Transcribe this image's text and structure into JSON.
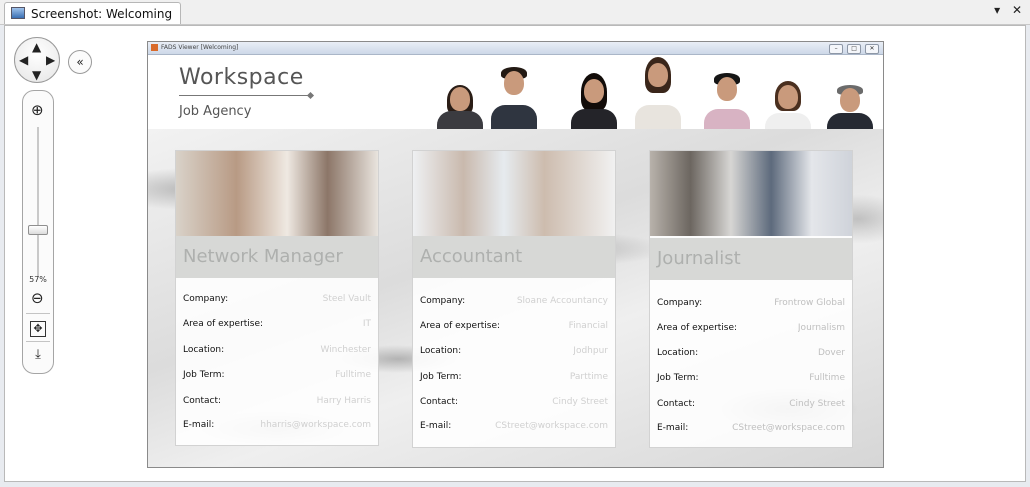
{
  "window": {
    "tab_label": "Screenshot: Welcoming",
    "dropdown_glyph": "▾",
    "close_glyph": "✕"
  },
  "navigator": {
    "zoom_percent": "57%",
    "zoom_level": 0.57,
    "icons": [
      "pan-arrows-icon",
      "collapse-panel-icon",
      "zoom-in-icon",
      "zoom-out-icon",
      "fit-to-window-icon",
      "export-icon"
    ]
  },
  "app": {
    "title": "FADS Viewer [Welcoming]",
    "controls": [
      "–",
      "□",
      "✕"
    ],
    "header": {
      "title": "Workspace",
      "subtitle": "Job Agency"
    }
  },
  "field_labels": {
    "company": "Company:",
    "expertise": "Area of expertise:",
    "location": "Location:",
    "term": "Job Term:",
    "contact": "Contact:",
    "email": "E-mail:"
  },
  "cards": [
    {
      "title": "Network Manager",
      "company": "Steel Vault",
      "expertise": "IT",
      "location": "Winchester",
      "term": "Fulltime",
      "contact": "Harry Harris",
      "email": "hharris@workspace.com"
    },
    {
      "title": "Accountant",
      "company": "Sloane Accountancy",
      "expertise": "Financial",
      "location": "Jodhpur",
      "term": "Parttime",
      "contact": "Cindy Street",
      "email": "CStreet@workspace.com"
    },
    {
      "title": "Journalist",
      "company": "Frontrow Global",
      "expertise": "Journalism",
      "location": "Dover",
      "term": "Fulltime",
      "contact": "Cindy Street",
      "email": "CStreet@workspace.com"
    }
  ],
  "colors": {
    "card_title_bg": "#d7d8d6",
    "card_title_text": "#aeb0ae",
    "value_text": "#d0d0d0"
  }
}
